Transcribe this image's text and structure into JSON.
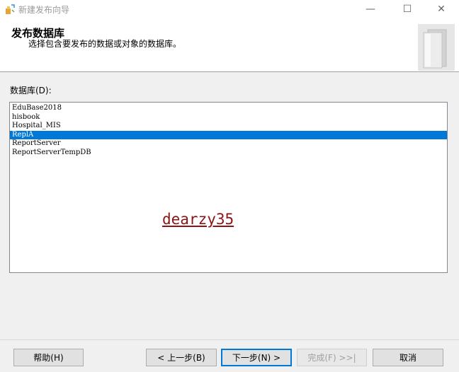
{
  "window": {
    "title": "新建发布向导",
    "minimize_glyph": "—",
    "maximize_glyph": "☐",
    "close_glyph": "✕"
  },
  "header": {
    "title": "发布数据库",
    "subtitle": "选择包含要发布的数据或对象的数据库。"
  },
  "databases": {
    "label": "数据库(D):",
    "items": [
      {
        "name": "EduBase2018",
        "selected": false
      },
      {
        "name": "hisbook",
        "selected": false
      },
      {
        "name": "Hospital_MIS",
        "selected": false
      },
      {
        "name": "ReplA",
        "selected": true
      },
      {
        "name": "ReportServer",
        "selected": false
      },
      {
        "name": "ReportServerTempDB",
        "selected": false
      }
    ]
  },
  "watermark": "dearzy35",
  "buttons": {
    "help": "帮助(H)",
    "back": "< 上一步(B)",
    "next": "下一步(N) >",
    "finish": "完成(F) >>|",
    "cancel": "取消"
  },
  "colors": {
    "selection": "#0078d7",
    "watermark": "#8b1414",
    "window_bg": "#f0f0f0"
  }
}
